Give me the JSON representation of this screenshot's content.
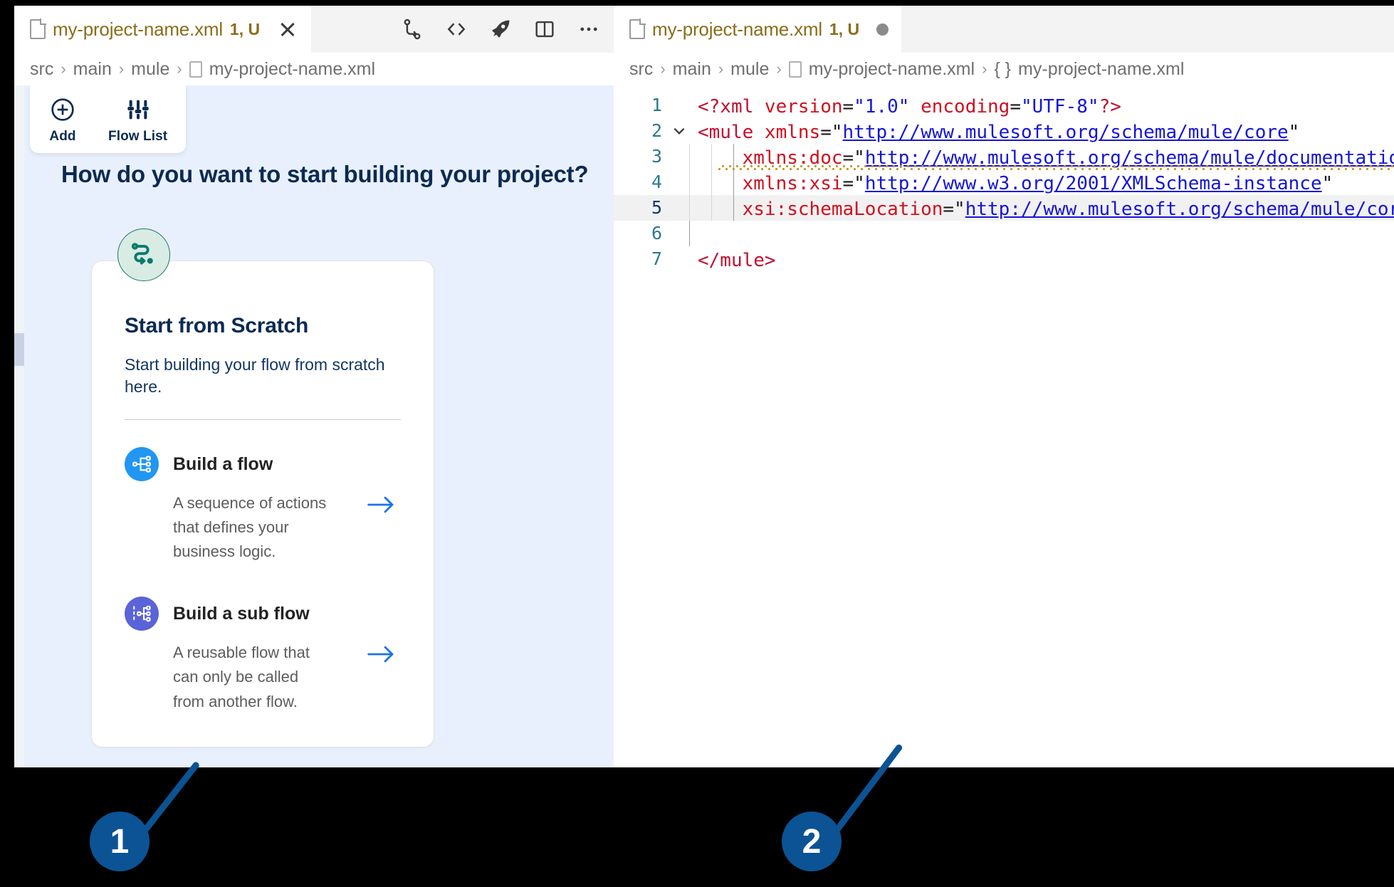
{
  "callouts": [
    {
      "number": "1"
    },
    {
      "number": "2"
    }
  ],
  "left_pane": {
    "tab": {
      "file_icon": "file-icon",
      "filename": "my-project-name.xml",
      "badge": "1, U",
      "close_icon": "close-icon"
    },
    "tabbar_actions": [
      {
        "name": "source-control-icon"
      },
      {
        "name": "code-brackets-icon"
      },
      {
        "name": "run-rocket-icon"
      },
      {
        "name": "split-editor-icon"
      },
      {
        "name": "more-actions-icon"
      }
    ],
    "breadcrumb": {
      "items": [
        "src",
        "main",
        "mule"
      ],
      "separator": "›",
      "file": "my-project-name.xml"
    },
    "toolbar": [
      {
        "label": "Add",
        "icon": "plus-circle-icon"
      },
      {
        "label": "Flow List",
        "icon": "flow-list-icon"
      }
    ],
    "title": "How do you want to start building your project?",
    "card": {
      "badge_icon": "route-path-icon",
      "heading": "Start from Scratch",
      "subtitle": "Start building your flow from scratch here.",
      "options": [
        {
          "icon": "flow-sitemap-icon",
          "icon_color": "#2196f3",
          "title": "Build a flow",
          "description": "A sequence of actions that defines your business logic.",
          "arrow_icon": "arrow-right-icon"
        },
        {
          "icon": "sub-flow-sitemap-icon",
          "icon_color": "#5a63d8",
          "title": "Build a sub flow",
          "description": "A reusable flow that can only be called from another flow.",
          "arrow_icon": "arrow-right-icon"
        }
      ]
    }
  },
  "right_pane": {
    "tab": {
      "file_icon": "file-icon",
      "filename": "my-project-name.xml",
      "badge": "1, U",
      "dirty_dot": "unsaved-dot"
    },
    "breadcrumb": {
      "items": [
        "src",
        "main",
        "mule"
      ],
      "separator": "›",
      "file": "my-project-name.xml",
      "symbol_brace": "{ }",
      "symbol": "my-project-name.xml"
    },
    "editor": {
      "active_line": 5,
      "lines": [
        {
          "number": "1",
          "indent": 0,
          "fold": false,
          "warn": false,
          "tokens": [
            {
              "t": "<?xml ",
              "c": "t-pi"
            },
            {
              "t": "version",
              "c": "t-attr"
            },
            {
              "t": "=",
              "c": "t-eq"
            },
            {
              "t": "\"1.0\"",
              "c": "t-val"
            },
            {
              "t": " ",
              "c": "t-eq"
            },
            {
              "t": "encoding",
              "c": "t-attr"
            },
            {
              "t": "=",
              "c": "t-eq"
            },
            {
              "t": "\"UTF‑8\"",
              "c": "t-val"
            },
            {
              "t": "?>",
              "c": "t-pi"
            }
          ]
        },
        {
          "number": "2",
          "indent": 0,
          "fold": true,
          "warn": false,
          "tokens": [
            {
              "t": "<mule ",
              "c": "t-tag"
            },
            {
              "t": "xmlns",
              "c": "t-attr"
            },
            {
              "t": "=",
              "c": "t-eq"
            },
            {
              "t": "\"",
              "c": "t-quote"
            },
            {
              "t": "http://www.mulesoft.org/schema/mule/core",
              "c": "t-link"
            },
            {
              "t": "\"",
              "c": "t-quote"
            }
          ]
        },
        {
          "number": "3",
          "indent": 3,
          "fold": false,
          "warn": true,
          "tokens": [
            {
              "t": "xmlns:doc",
              "c": "t-attr"
            },
            {
              "t": "=",
              "c": "t-eq"
            },
            {
              "t": "\"",
              "c": "t-quote"
            },
            {
              "t": "http://www.mulesoft.org/schema/mule/documentation",
              "c": "t-link"
            },
            {
              "t": "\"",
              "c": "t-quote"
            }
          ]
        },
        {
          "number": "4",
          "indent": 3,
          "fold": false,
          "warn": false,
          "tokens": [
            {
              "t": "xmlns:xsi",
              "c": "t-attr"
            },
            {
              "t": "=",
              "c": "t-eq"
            },
            {
              "t": "\"",
              "c": "t-quote"
            },
            {
              "t": "http://www.w3.org/2001/XMLSchema‑instance",
              "c": "t-link"
            },
            {
              "t": "\"",
              "c": "t-quote"
            }
          ]
        },
        {
          "number": "5",
          "indent": 3,
          "fold": false,
          "warn": false,
          "tokens": [
            {
              "t": "xsi:schemaLocation",
              "c": "t-attr"
            },
            {
              "t": "=",
              "c": "t-eq"
            },
            {
              "t": "\"",
              "c": "t-quote"
            },
            {
              "t": "http://www.mulesoft.org/schema/mule/core ",
              "c": "t-link"
            }
          ]
        },
        {
          "number": "6",
          "indent": 1,
          "fold": false,
          "warn": false,
          "tokens": []
        },
        {
          "number": "7",
          "indent": 0,
          "fold": false,
          "warn": false,
          "tokens": [
            {
              "t": "</mule>",
              "c": "t-tag"
            }
          ]
        }
      ]
    }
  },
  "colors": {
    "callout": "#0b5394",
    "left_bg": "#e9f0fd",
    "brand_navy": "#0b2a52",
    "teal": "#17776a",
    "blue_icon": "#2196f3",
    "purple_icon": "#5a63d8",
    "tab_text": "#8a6d1a"
  }
}
